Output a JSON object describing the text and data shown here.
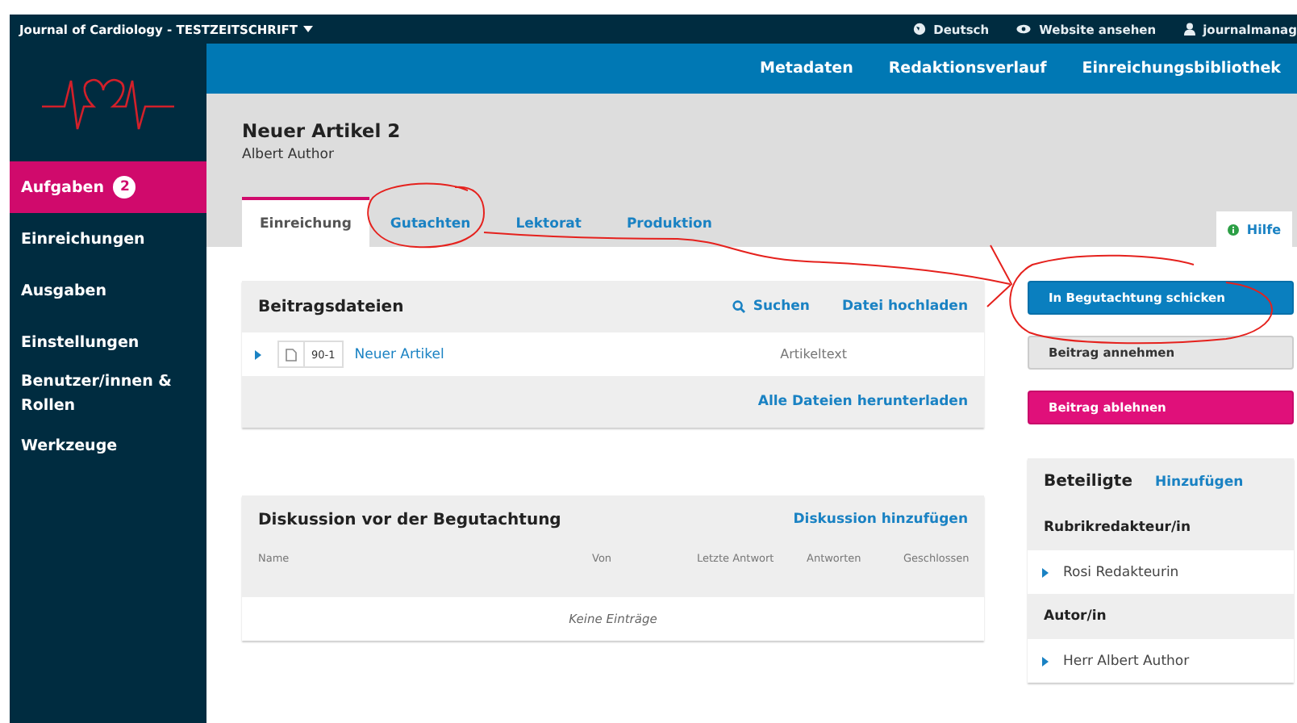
{
  "topbar": {
    "journal": "Journal of Cardiology - TESTZEITSCHRIFT",
    "links": [
      {
        "kind": "language",
        "label": "Deutsch"
      },
      {
        "kind": "view",
        "label": "Website ansehen"
      },
      {
        "kind": "user",
        "label": "journalmanag"
      }
    ]
  },
  "sidebar": {
    "items": [
      {
        "label": "Aufgaben",
        "badge": "2",
        "selected": true
      },
      {
        "label": "Einreichungen",
        "selected": false
      },
      {
        "label": "Ausgaben",
        "selected": false
      },
      {
        "label": "Einstellungen",
        "selected": false
      },
      {
        "label": "Benutzer/innen & Rollen",
        "selected": false
      },
      {
        "label": "Werkzeuge",
        "selected": false
      }
    ]
  },
  "header_nav": [
    "Metadaten",
    "Redaktionsverlauf",
    "Einreichungsbibliothek"
  ],
  "submission": {
    "title": "Neuer Artikel 2",
    "author": "Albert Author"
  },
  "tabs": [
    {
      "label": "Einreichung",
      "selected": true
    },
    {
      "label": "Gutachten",
      "selected": false
    },
    {
      "label": "Lektorat",
      "selected": false
    },
    {
      "label": "Produktion",
      "selected": false
    }
  ],
  "help_tab": "Hilfe",
  "files_panel": {
    "title": "Beitragsdateien",
    "actions": [
      {
        "kind": "search",
        "label": "Suchen"
      },
      {
        "kind": "plain",
        "label": "Datei hochladen"
      }
    ],
    "rows": [
      {
        "id": "90-1",
        "name": "Neuer Artikel",
        "type": "Artikeltext"
      }
    ],
    "footer_link": "Alle Dateien herunterladen"
  },
  "discussion_panel": {
    "title": "Diskussion vor der Begutachtung",
    "action": "Diskussion hinzufügen",
    "columns": [
      "Name",
      "Von",
      "Letzte Antwort",
      "Antworten",
      "Geschlossen"
    ],
    "empty": "Keine Einträge"
  },
  "decision_buttons": [
    {
      "kind": "primary",
      "label": "In Begutachtung schicken"
    },
    {
      "kind": "default",
      "label": "Beitrag annehmen"
    },
    {
      "kind": "danger",
      "label": "Beitrag ablehnen"
    }
  ],
  "participants": {
    "title": "Beteiligte",
    "action": "Hinzufügen",
    "groups": [
      {
        "role": "Rubrikredakteur/in",
        "members": [
          "Rosi Redakteurin"
        ]
      },
      {
        "role": "Autor/in",
        "members": [
          "Herr Albert Author"
        ]
      }
    ]
  }
}
